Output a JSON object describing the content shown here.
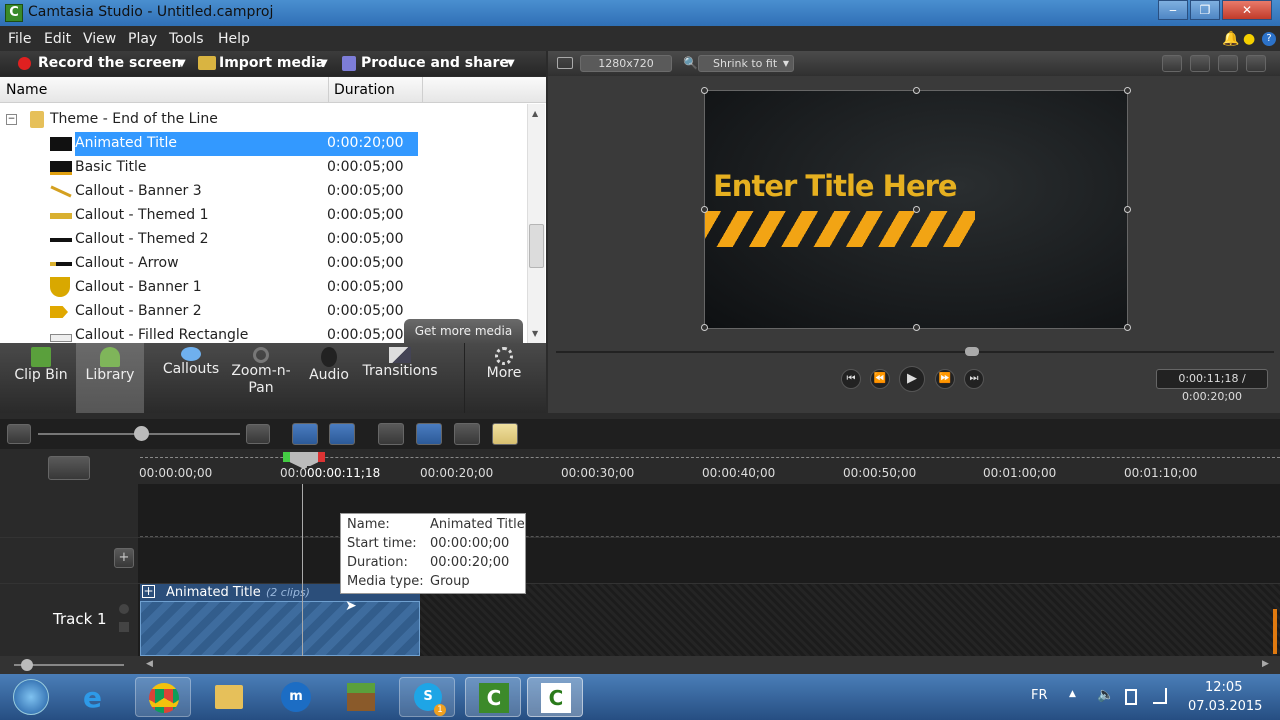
{
  "window": {
    "title": "Camtasia Studio - Untitled.camproj"
  },
  "menu": [
    "File",
    "Edit",
    "View",
    "Play",
    "Tools",
    "Help"
  ],
  "toolbar": {
    "record": "Record the screen",
    "import": "Import media",
    "produce": "Produce and share"
  },
  "library": {
    "columns": {
      "name": "Name",
      "duration": "Duration"
    },
    "folder": "Theme - End of the Line",
    "items": [
      {
        "name": "Animated Title",
        "duration": "0:00:20;00",
        "selected": true
      },
      {
        "name": "Basic Title",
        "duration": "0:00:05;00"
      },
      {
        "name": "Callout - Banner 3",
        "duration": "0:00:05;00"
      },
      {
        "name": "Callout - Themed 1",
        "duration": "0:00:05;00"
      },
      {
        "name": "Callout - Themed 2",
        "duration": "0:00:05;00"
      },
      {
        "name": "Callout - Arrow",
        "duration": "0:00:05;00"
      },
      {
        "name": "Callout - Banner 1",
        "duration": "0:00:05;00"
      },
      {
        "name": "Callout - Banner 2",
        "duration": "0:00:05;00"
      },
      {
        "name": "Callout - Filled Rectangle",
        "duration": "0:00:05;00"
      }
    ],
    "get_more": "Get more media"
  },
  "tabs": [
    "Clip Bin",
    "Library",
    "Callouts",
    "Zoom-n-Pan",
    "Audio",
    "Transitions",
    "More"
  ],
  "preview": {
    "resolution": "1280x720",
    "zoom": "Shrink to fit",
    "video_title": "Enter Title Here",
    "time": "0:00:11;18 / 0:00:20;00",
    "scrub_position": 0.58
  },
  "timeline": {
    "playhead": "00:00:11;18",
    "playhead_cut": "00:0",
    "ticks": [
      "00:00:00;00",
      "00:00:20;00",
      "00:00:30;00",
      "00:00:40;00",
      "00:00:50;00",
      "00:01:00;00",
      "00:01:10;00"
    ],
    "track_name": "Track 1",
    "clip_name": "Animated Title",
    "clip_count": "(2 clips)",
    "tooltip": {
      "name_k": "Name:",
      "name_v": "Animated Title",
      "start_k": "Start time:",
      "start_v": "00:00:00;00",
      "dur_k": "Duration:",
      "dur_v": "00:00:20;00",
      "type_k": "Media type:",
      "type_v": "Group"
    }
  },
  "tray": {
    "lang": "FR",
    "time": "12:05",
    "date": "07.03.2015"
  },
  "colors": {
    "accent": "#3399ff",
    "selection": "#3399ff",
    "title_yellow": "#e6b020"
  }
}
